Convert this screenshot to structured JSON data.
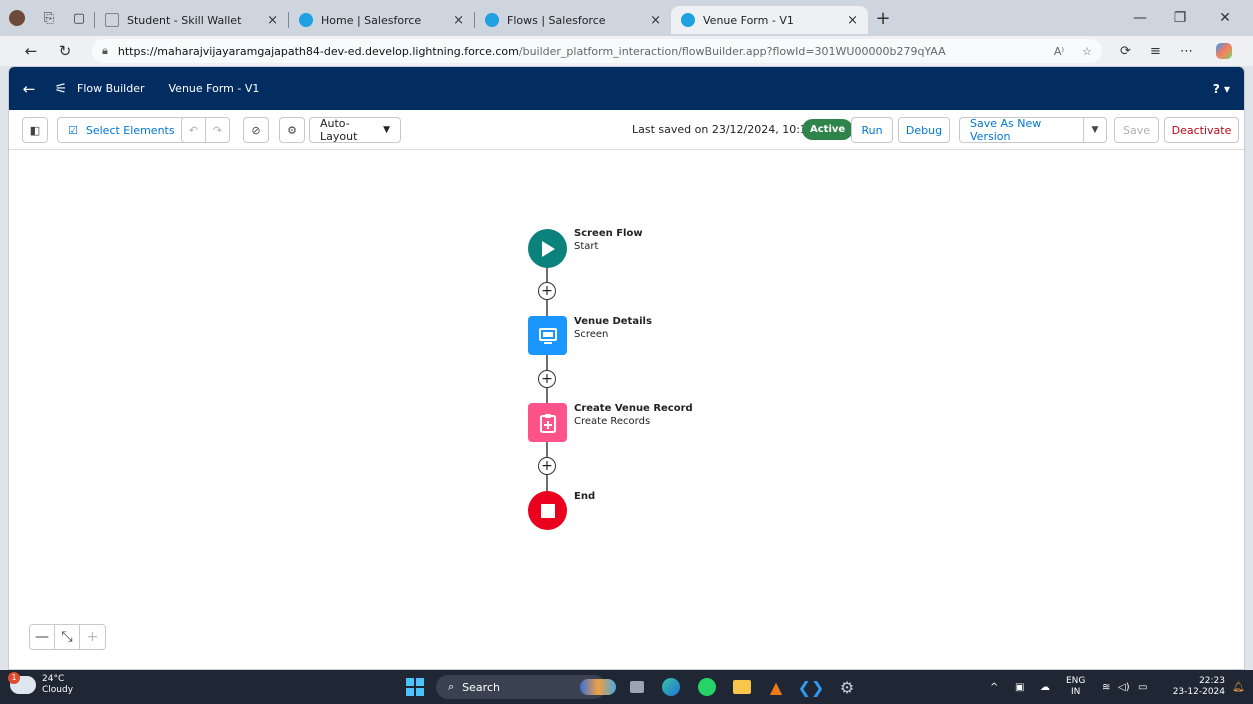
{
  "browser": {
    "tabs": [
      {
        "label": "Student - Skill Wallet",
        "active": false,
        "favicon_color": "#7d8794"
      },
      {
        "label": "Home | Salesforce",
        "active": false,
        "favicon_color": "#1ea1e0"
      },
      {
        "label": "Flows | Salesforce",
        "active": false,
        "favicon_color": "#1ea1e0"
      },
      {
        "label": "Venue Form - V1",
        "active": true,
        "favicon_color": "#1ea1e0"
      }
    ],
    "close_glyph": "×",
    "new_tab_glyph": "+",
    "url_host": "https://maharajvijayaramgajapath84-dev-ed.develop.lightning.force.com",
    "url_path": "/builder_platform_interaction/flowBuilder.app?flowId=301WU00000b279qYAA"
  },
  "header": {
    "app_title": "Flow Builder",
    "flow_name": "Venue Form - V1",
    "help_label": "? ▾"
  },
  "toolbar": {
    "select_elements_label": "Select Elements",
    "layout_label": "Auto-Layout",
    "last_saved": "Last saved on 23/12/2024, 10:18 pm",
    "status_badge": "Active",
    "run_label": "Run",
    "debug_label": "Debug",
    "save_as_new_label": "Save As New Version",
    "save_label": "Save",
    "deactivate_label": "Deactivate"
  },
  "flow": {
    "nodes": [
      {
        "title": "Screen Flow",
        "subtitle": "Start",
        "color": "#0b827c",
        "icon": "play-icon"
      },
      {
        "title": "Venue Details",
        "subtitle": "Screen",
        "color": "#1b96ff",
        "icon": "screen-icon"
      },
      {
        "title": "Create Venue Record",
        "subtitle": "Create Records",
        "color": "#ff538a",
        "icon": "create-record-icon"
      },
      {
        "title": "End",
        "subtitle": "",
        "color": "#ea001e",
        "icon": "stop-icon"
      }
    ]
  },
  "zoom": {
    "minus": "—",
    "fit": "⤡",
    "plus": "+"
  },
  "taskbar": {
    "weather_temp": "24°C",
    "weather_desc": "Cloudy",
    "weather_badge": "1",
    "search_label": "Search",
    "lang_line1": "ENG",
    "lang_line2": "IN",
    "time": "22:23",
    "date": "23-12-2024"
  }
}
